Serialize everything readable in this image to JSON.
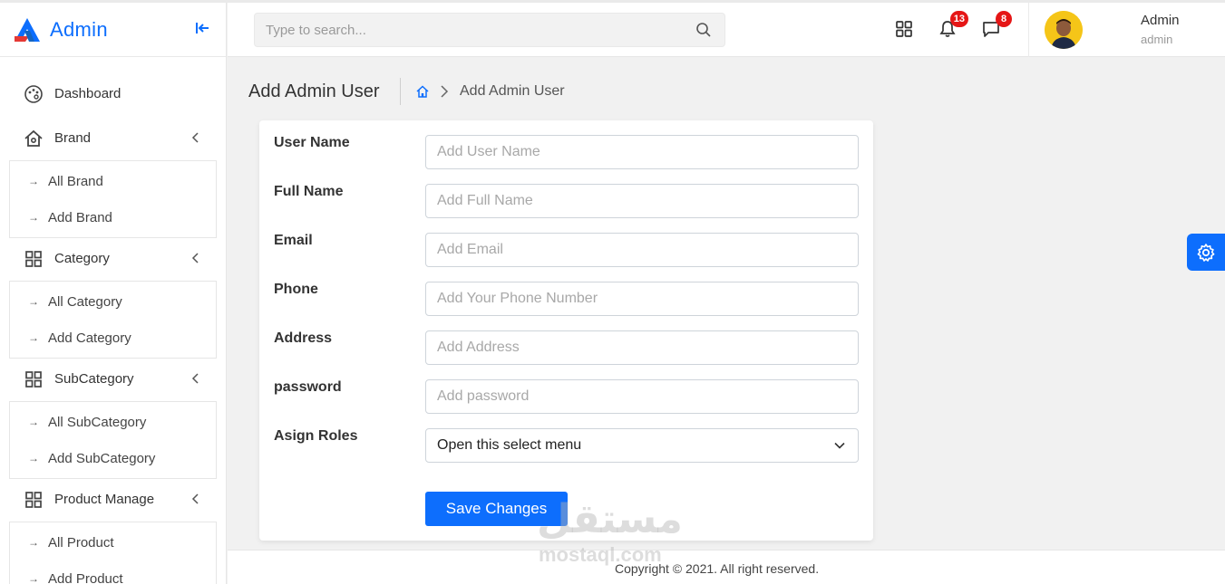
{
  "app": {
    "name": "Admin"
  },
  "sidebar": {
    "collapse_icon": "collapse-left-icon",
    "items": [
      {
        "label": "Dashboard",
        "icon": "palette-icon",
        "has_sub": false
      },
      {
        "label": "Brand",
        "icon": "home-icon",
        "has_sub": true,
        "sub": [
          "All Brand",
          "Add Brand"
        ]
      },
      {
        "label": "Category",
        "icon": "grid-icon",
        "has_sub": true,
        "sub": [
          "All Category",
          "Add Category"
        ]
      },
      {
        "label": "SubCategory",
        "icon": "grid-icon",
        "has_sub": true,
        "sub": [
          "All SubCategory",
          "Add SubCategory"
        ]
      },
      {
        "label": "Product Manage",
        "icon": "grid-icon",
        "has_sub": true,
        "sub": [
          "All Product",
          "Add Product"
        ]
      }
    ]
  },
  "header": {
    "search_placeholder": "Type to search...",
    "notifications_count": "13",
    "messages_count": "8",
    "user": {
      "name": "Admin",
      "role": "admin"
    }
  },
  "page": {
    "title": "Add Admin User",
    "breadcrumb_current": "Add Admin User"
  },
  "form": {
    "fields": [
      {
        "label": "User Name",
        "placeholder": "Add User Name"
      },
      {
        "label": "Full Name",
        "placeholder": "Add Full Name"
      },
      {
        "label": "Email",
        "placeholder": "Add Email"
      },
      {
        "label": "Phone",
        "placeholder": "Add Your Phone Number"
      },
      {
        "label": "Address",
        "placeholder": "Add Address"
      },
      {
        "label": "password",
        "placeholder": "Add password"
      }
    ],
    "roles": {
      "label": "Asign Roles",
      "selected": "Open this select menu"
    },
    "submit_label": "Save Changes"
  },
  "footer": {
    "text": "Copyright © 2021. All right reserved."
  },
  "watermark": {
    "arabic": "مستقل",
    "latin": "mostaql.com"
  },
  "colors": {
    "primary": "#0d6efd",
    "badge": "#e51616",
    "page_bg": "#f1f1f1"
  }
}
